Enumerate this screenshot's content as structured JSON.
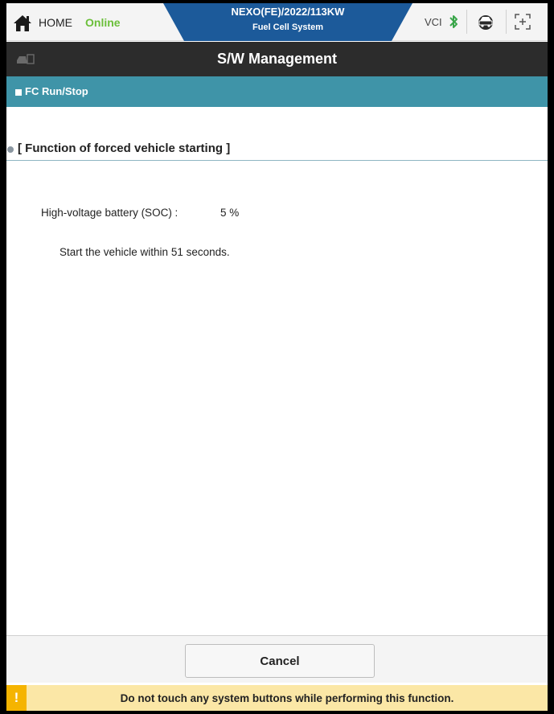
{
  "header": {
    "home_label": "HOME",
    "status": "Online",
    "vehicle": "NEXO(FE)/2022/113KW",
    "system": "Fuel Cell System",
    "vci_label": "VCI",
    "icons": [
      "home-icon",
      "bluetooth-icon",
      "car-globe-icon",
      "scan-icon"
    ],
    "accent_color": "#1c5a9a",
    "status_color": "#6bbf3a"
  },
  "titlebar": {
    "title": "S/W Management"
  },
  "section": {
    "title": "FC Run/Stop",
    "color": "#3f94a8"
  },
  "content": {
    "heading": "[ Function of forced vehicle starting ]",
    "soc_label": "High-voltage battery (SOC) :",
    "soc_value": "5 %",
    "message": "Start the vehicle within 51 seconds."
  },
  "footer": {
    "cancel_label": "Cancel",
    "warning_badge": "!",
    "warning": "Do not touch any system buttons while performing this function."
  }
}
